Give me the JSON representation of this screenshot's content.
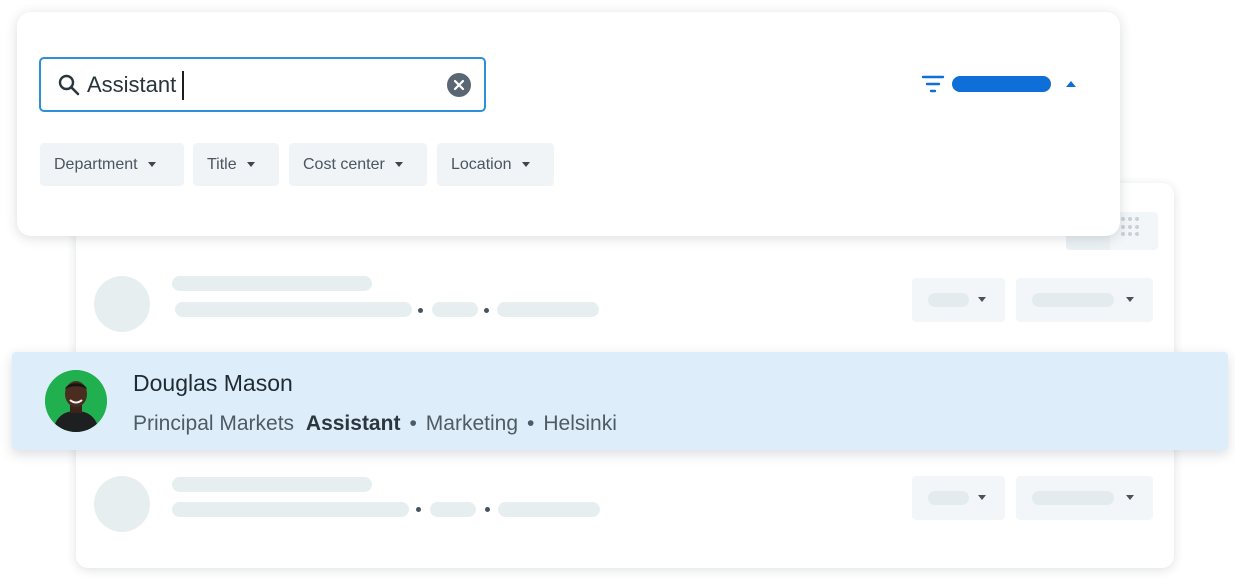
{
  "search": {
    "value": "Assistant",
    "clear_icon": "x-circle-icon",
    "search_icon": "magnifier-icon"
  },
  "filters": [
    {
      "label": "Department"
    },
    {
      "label": "Title"
    },
    {
      "label": "Cost center"
    },
    {
      "label": "Location"
    }
  ],
  "toolbar": {
    "filter_icon": "filter-lines-icon",
    "collapse_icon": "chevron-up-icon",
    "accent": "#0f6fd8"
  },
  "result": {
    "name": "Douglas Mason",
    "title_prefix": "Principal Markets",
    "title_match": "Assistant",
    "department": "Marketing",
    "location": "Helsinki",
    "separator": "•",
    "highlight_color": "#deedfa"
  },
  "grid_icon": "grid-dots-icon"
}
